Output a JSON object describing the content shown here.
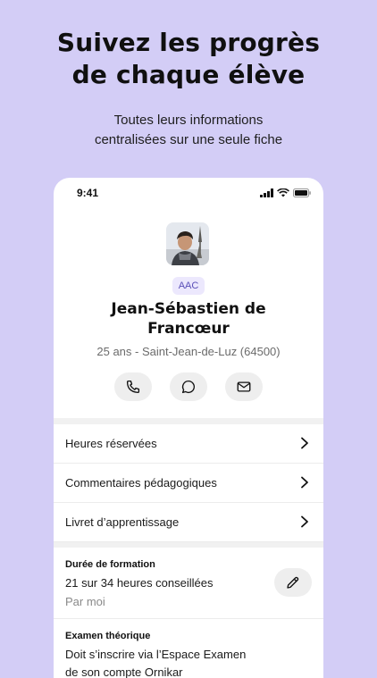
{
  "promo": {
    "headline_line1": "Suivez les progrès",
    "headline_line2": "de chaque élève",
    "sub_line1": "Toutes leurs informations",
    "sub_line2": "centralisées sur une seule fiche"
  },
  "status_bar": {
    "time": "9:41"
  },
  "profile": {
    "badge": "AAC",
    "name_line1": "Jean-Sébastien de",
    "name_line2": "Francœur",
    "meta": "25 ans - Saint-Jean-de-Luz (64500)"
  },
  "menu": {
    "items": [
      {
        "label": "Heures réservées"
      },
      {
        "label": "Commentaires pédagogiques"
      },
      {
        "label": "Livret d’apprentissage"
      }
    ]
  },
  "training": {
    "label": "Durée de formation",
    "value": "21 sur 34 heures conseillées",
    "sub": "Par moi"
  },
  "exam": {
    "label": "Examen théorique",
    "value_line1": "Doit s’inscrire via l’Espace Examen",
    "value_line2": "de son compte Ornikar"
  },
  "colors": {
    "background": "#d3cdf6",
    "badge_bg": "#ece8fd",
    "badge_text": "#5a4fb8"
  }
}
